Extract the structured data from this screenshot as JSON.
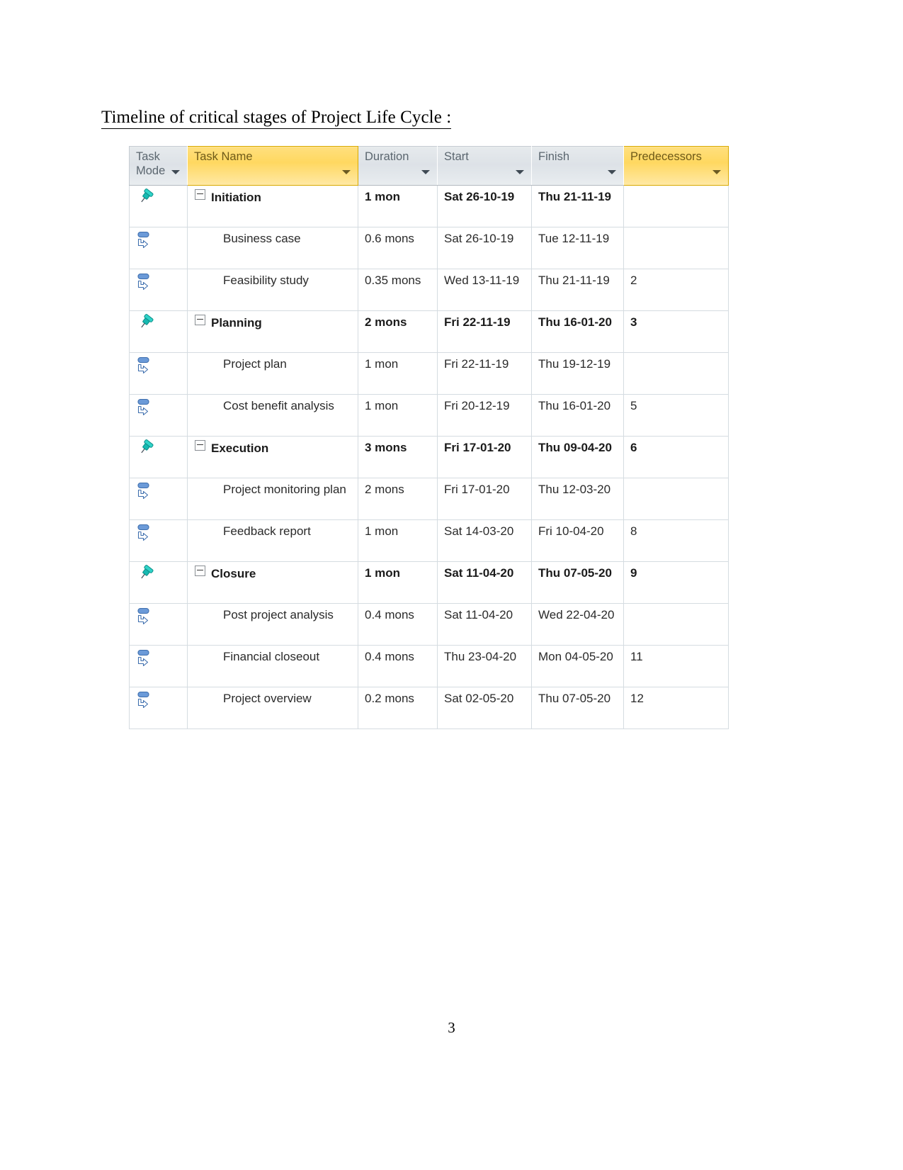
{
  "document": {
    "heading": "Timeline of critical stages of Project Life Cycle :",
    "page_number": "3"
  },
  "colors": {
    "header_highlight": "#ffd860",
    "header_background": "#e3e8ec",
    "header_text": "#5b666f",
    "grid_line": "#d5dce1",
    "pin_icon": "#19b6b0",
    "auto_icon": "#5b8fd0"
  },
  "table": {
    "columns": [
      {
        "key": "task_mode",
        "label": "Task Mode",
        "filter": true,
        "highlight": false
      },
      {
        "key": "task_name",
        "label": "Task Name",
        "filter": true,
        "highlight": true
      },
      {
        "key": "duration",
        "label": "Duration",
        "filter": true,
        "highlight": false
      },
      {
        "key": "start",
        "label": "Start",
        "filter": true,
        "highlight": false
      },
      {
        "key": "finish",
        "label": "Finish",
        "filter": true,
        "highlight": false
      },
      {
        "key": "predecessors",
        "label": "Predecessors",
        "filter": true,
        "highlight": true
      }
    ],
    "rows": [
      {
        "mode_icon": "pin-icon",
        "mode": "manually-scheduled",
        "summary": true,
        "collapse": true,
        "name": "Initiation",
        "duration": "1 mon",
        "start": "Sat 26-10-19",
        "finish": "Thu 21-11-19",
        "predecessors": ""
      },
      {
        "mode_icon": "auto-schedule-icon",
        "mode": "auto-scheduled",
        "summary": false,
        "collapse": false,
        "name": "Business case",
        "duration": "0.6 mons",
        "start": "Sat 26-10-19",
        "finish": "Tue 12-11-19",
        "predecessors": ""
      },
      {
        "mode_icon": "auto-schedule-icon",
        "mode": "auto-scheduled",
        "summary": false,
        "collapse": false,
        "name": "Feasibility study",
        "duration": "0.35 mons",
        "start": "Wed 13-11-19",
        "finish": "Thu 21-11-19",
        "predecessors": "2"
      },
      {
        "mode_icon": "pin-icon",
        "mode": "manually-scheduled",
        "summary": true,
        "collapse": true,
        "name": "Planning",
        "duration": "2 mons",
        "start": "Fri 22-11-19",
        "finish": "Thu 16-01-20",
        "predecessors": "3"
      },
      {
        "mode_icon": "auto-schedule-icon",
        "mode": "auto-scheduled",
        "summary": false,
        "collapse": false,
        "name": "Project plan",
        "duration": "1 mon",
        "start": "Fri 22-11-19",
        "finish": "Thu 19-12-19",
        "predecessors": ""
      },
      {
        "mode_icon": "auto-schedule-icon",
        "mode": "auto-scheduled",
        "summary": false,
        "collapse": false,
        "name": "Cost benefit analysis",
        "duration": "1 mon",
        "start": "Fri 20-12-19",
        "finish": "Thu 16-01-20",
        "predecessors": "5"
      },
      {
        "mode_icon": "pin-icon",
        "mode": "manually-scheduled",
        "summary": true,
        "collapse": true,
        "name": "Execution",
        "duration": "3 mons",
        "start": "Fri 17-01-20",
        "finish": "Thu 09-04-20",
        "predecessors": "6"
      },
      {
        "mode_icon": "auto-schedule-icon",
        "mode": "auto-scheduled",
        "summary": false,
        "collapse": false,
        "name": "Project monitoring plan",
        "duration": "2 mons",
        "start": "Fri 17-01-20",
        "finish": "Thu 12-03-20",
        "predecessors": ""
      },
      {
        "mode_icon": "auto-schedule-icon",
        "mode": "auto-scheduled",
        "summary": false,
        "collapse": false,
        "name": "Feedback report",
        "duration": "1 mon",
        "start": "Sat 14-03-20",
        "finish": "Fri 10-04-20",
        "predecessors": "8"
      },
      {
        "mode_icon": "pin-icon",
        "mode": "manually-scheduled",
        "summary": true,
        "collapse": true,
        "name": "Closure",
        "duration": "1 mon",
        "start": "Sat 11-04-20",
        "finish": "Thu 07-05-20",
        "predecessors": "9"
      },
      {
        "mode_icon": "auto-schedule-icon",
        "mode": "auto-scheduled",
        "summary": false,
        "collapse": false,
        "name": "Post project analysis",
        "duration": "0.4 mons",
        "start": "Sat 11-04-20",
        "finish": "Wed 22-04-20",
        "predecessors": ""
      },
      {
        "mode_icon": "auto-schedule-icon",
        "mode": "auto-scheduled",
        "summary": false,
        "collapse": false,
        "name": "Financial closeout",
        "duration": "0.4 mons",
        "start": "Thu 23-04-20",
        "finish": "Mon 04-05-20",
        "predecessors": "11"
      },
      {
        "mode_icon": "auto-schedule-icon",
        "mode": "auto-scheduled",
        "summary": false,
        "collapse": false,
        "name": "Project overview",
        "duration": "0.2 mons",
        "start": "Sat 02-05-20",
        "finish": "Thu 07-05-20",
        "predecessors": "12"
      }
    ]
  }
}
